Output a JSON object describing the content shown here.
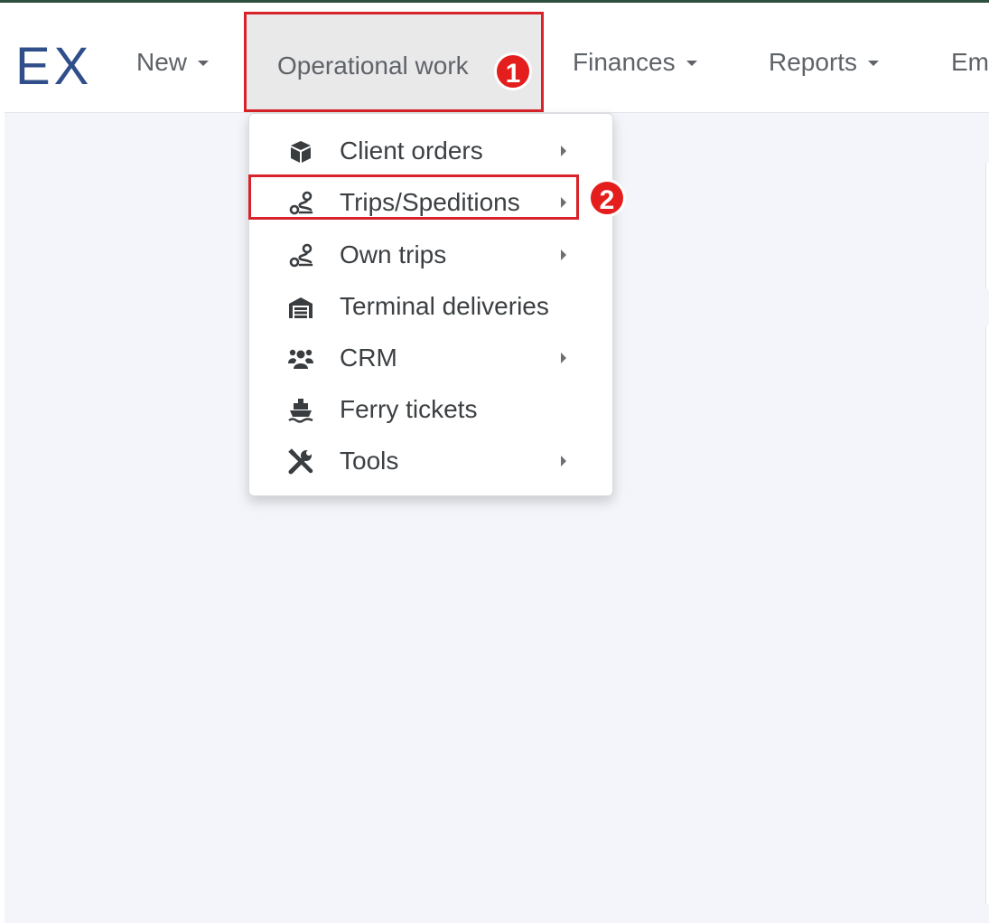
{
  "navbar": {
    "brand": "EX",
    "items": [
      {
        "label": "New"
      },
      {
        "label": "Operational work"
      },
      {
        "label": "Finances"
      },
      {
        "label": "Reports"
      },
      {
        "label": "Em"
      }
    ]
  },
  "annotations": {
    "step1": "1",
    "step2": "2",
    "marker_color": "#e41d1d"
  },
  "dropdown": {
    "items": [
      {
        "label": "Client orders",
        "icon": "box-icon",
        "has_submenu": true
      },
      {
        "label": "Trips/Speditions",
        "icon": "route-icon",
        "has_submenu": true
      },
      {
        "label": "Own trips",
        "icon": "route-icon",
        "has_submenu": true
      },
      {
        "label": "Terminal deliveries",
        "icon": "warehouse-icon",
        "has_submenu": false
      },
      {
        "label": "CRM",
        "icon": "users-icon",
        "has_submenu": true
      },
      {
        "label": "Ferry tickets",
        "icon": "ship-icon",
        "has_submenu": false
      },
      {
        "label": "Tools",
        "icon": "tools-icon",
        "has_submenu": true
      }
    ]
  }
}
